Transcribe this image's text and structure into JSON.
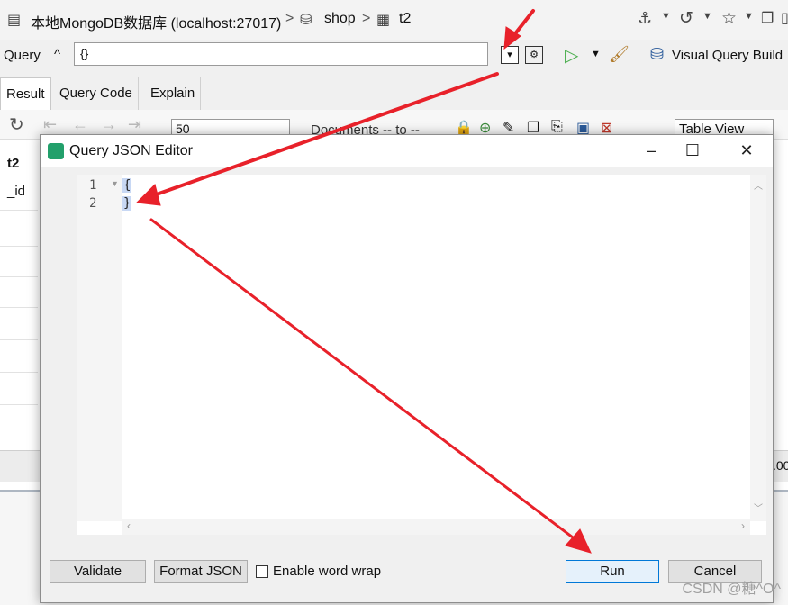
{
  "breadcrumb": {
    "db": "本地MongoDB数据库 (localhost:27017)",
    "sep1": ">",
    "collection_db": "shop",
    "sep2": ">",
    "collection": "t2"
  },
  "querybar": {
    "label": "Query",
    "caret": "^",
    "value": "{}",
    "visual_query_builder": "Visual Query Build"
  },
  "tabs": [
    "Result",
    "Query Code",
    "Explain"
  ],
  "result_toolbar": {
    "page_size": "50",
    "documents_range": "Documents -- to --",
    "view_mode": "Table View"
  },
  "grid": {
    "title": "t2",
    "column": "_id",
    "status_value": ".00"
  },
  "dialog": {
    "title": "Query JSON Editor",
    "lines": [
      "1",
      "2"
    ],
    "code": [
      "{",
      "}"
    ],
    "validate": "Validate",
    "format_json": "Format JSON",
    "word_wrap_label": "Enable word wrap",
    "run": "Run",
    "cancel": "Cancel"
  },
  "watermark": "CSDN @糖^O^",
  "colors": {
    "annotation_arrow": "#e8212a",
    "run_border": "#0078d7",
    "selection": "#c8d8f4"
  }
}
